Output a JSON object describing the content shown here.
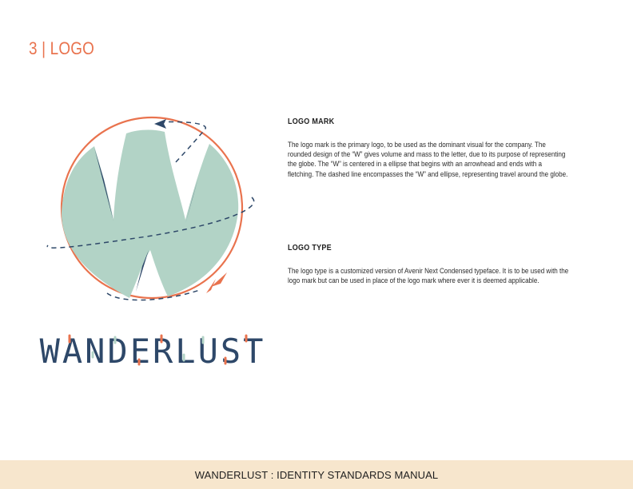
{
  "page": {
    "section_heading": "3 | LOGO"
  },
  "logo": {
    "wordmark": "WANDERLUST",
    "colors": {
      "navy": "#2e4869",
      "mint": "#b2d3c6",
      "coral": "#e9734e",
      "cream": "#f7e6cd"
    }
  },
  "logo_mark": {
    "title": "LOGO MARK",
    "body": "The logo mark is the primary logo, to be used as the dominant visual for the company. The rounded design of the “W” gives volume and mass to the letter, due to its purpose of representing the globe. The “W” is centered in a ellipse that begins with an arrowhead and ends with a fletching. The dashed line encompasses the “W” and ellipse, representing travel around the globe."
  },
  "logo_type": {
    "title": "LOGO TYPE",
    "body": "The logo type is a customized version of Avenir Next Condensed typeface. It is to be used with the logo mark but can be used in place of the logo mark where ever it is deemed applicable."
  },
  "footer": {
    "text": "WANDERLUST : IDENTITY STANDARDS MANUAL"
  }
}
